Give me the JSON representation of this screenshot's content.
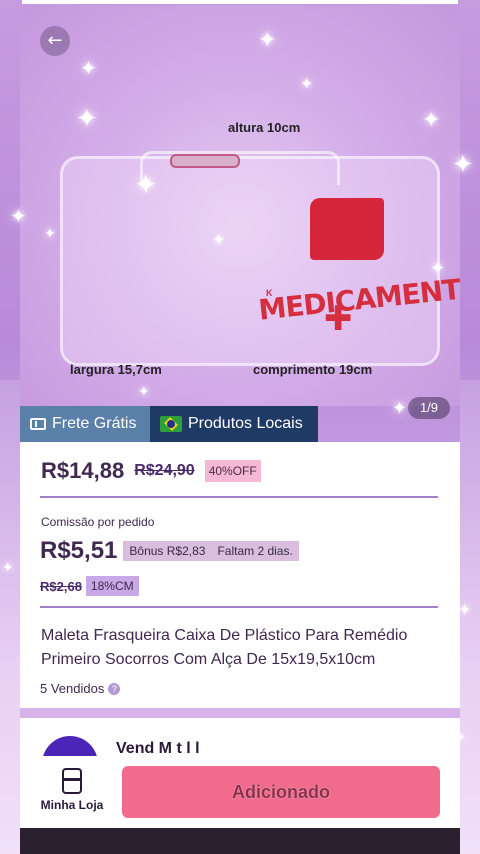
{
  "product_image": {
    "dimension_labels": {
      "height": "altura 10cm",
      "width": "largura 15,7cm",
      "length": "comprimento 19cm"
    },
    "case_text": "MEDICAMENTOS",
    "counter": "1/9"
  },
  "badges": {
    "frete": "Frete Grátis",
    "locais": "Produtos Locais"
  },
  "price": {
    "current": "R$14,88",
    "original": "R$24,90",
    "discount": "40%OFF"
  },
  "commission": {
    "label": "Comissão por pedido",
    "value": "R$5,51",
    "bonus": "Bônus R$2,83",
    "remaining": "Faltam 2 dias.",
    "old_value": "R$2,68",
    "rate": "18%CM"
  },
  "product": {
    "title": "Maleta Frasqueira Caixa De Plástico Para Remédio Primeiro Socorros Com Alça De 15x19,5x10cm",
    "sold": "5 Vendidos"
  },
  "store": {
    "name": "Vend  M   t  l   l"
  },
  "bottom": {
    "my_store": "Minha Loja",
    "add_button": "Adicionado"
  },
  "colors": {
    "accent": "#f06b8c",
    "frete_badge": "#5a7fa8",
    "locais_badge": "#203a66",
    "text_primary": "#402850"
  }
}
